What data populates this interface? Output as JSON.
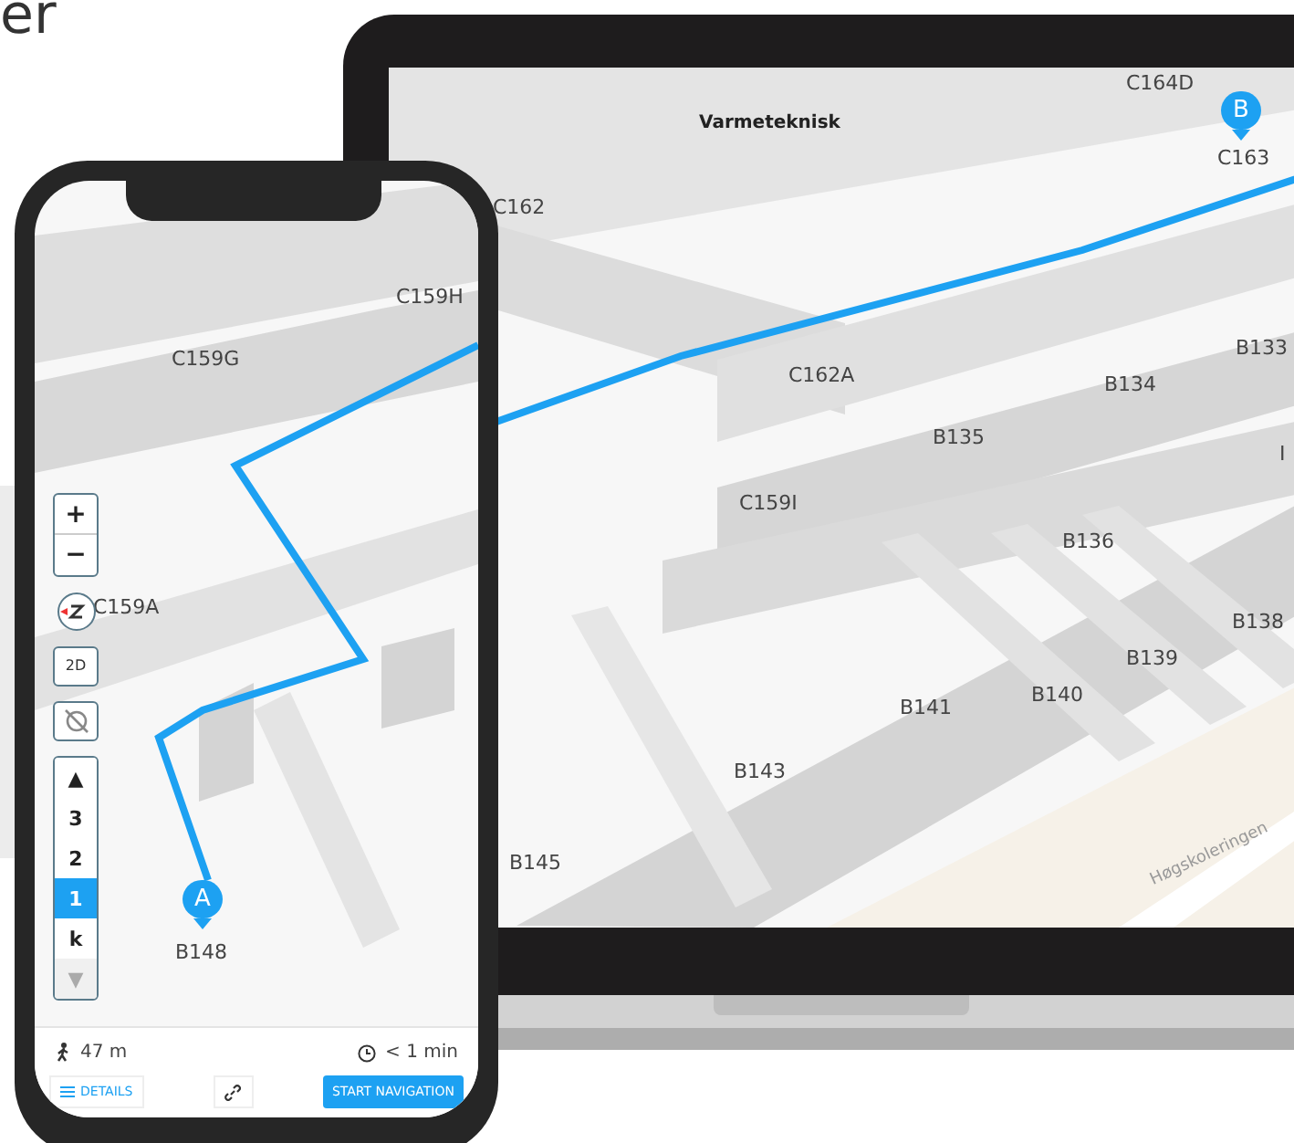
{
  "heading": "er",
  "laptop": {
    "labels": [
      {
        "text": "C164D",
        "kind": "room"
      },
      {
        "text": "Varmeteknisk",
        "kind": "area"
      },
      {
        "text": "C162",
        "kind": "room"
      },
      {
        "text": "C162A",
        "kind": "room"
      },
      {
        "text": "B133",
        "kind": "room"
      },
      {
        "text": "B134",
        "kind": "room"
      },
      {
        "text": "B135",
        "kind": "room"
      },
      {
        "text": "C159I",
        "kind": "room"
      },
      {
        "text": "I",
        "kind": "room"
      },
      {
        "text": "B136",
        "kind": "room"
      },
      {
        "text": "B138",
        "kind": "room"
      },
      {
        "text": "B139",
        "kind": "room"
      },
      {
        "text": "B140",
        "kind": "room"
      },
      {
        "text": "B141",
        "kind": "room"
      },
      {
        "text": "B143",
        "kind": "room"
      },
      {
        "text": "B145",
        "kind": "room"
      }
    ],
    "street": "Høgskoleringen",
    "marker": {
      "letter": "B",
      "label": "C163"
    }
  },
  "phone": {
    "labels": [
      {
        "text": "C159H"
      },
      {
        "text": "C159G"
      },
      {
        "text": "C159A"
      }
    ],
    "marker": {
      "letter": "A",
      "label": "B148"
    },
    "zoom": [
      "+",
      "−"
    ],
    "view_toggle": "2D",
    "floors": [
      {
        "label": "▲",
        "selected": false,
        "disabled": false
      },
      {
        "label": "3",
        "selected": false,
        "disabled": false
      },
      {
        "label": "2",
        "selected": false,
        "disabled": false
      },
      {
        "label": "1",
        "selected": true,
        "disabled": false
      },
      {
        "label": "k",
        "selected": false,
        "disabled": false
      },
      {
        "label": "▼",
        "selected": false,
        "disabled": true
      }
    ],
    "distance": "47 m",
    "duration": "< 1 min",
    "details_button": "DETAILS",
    "start_button": "START NAVIGATION"
  }
}
